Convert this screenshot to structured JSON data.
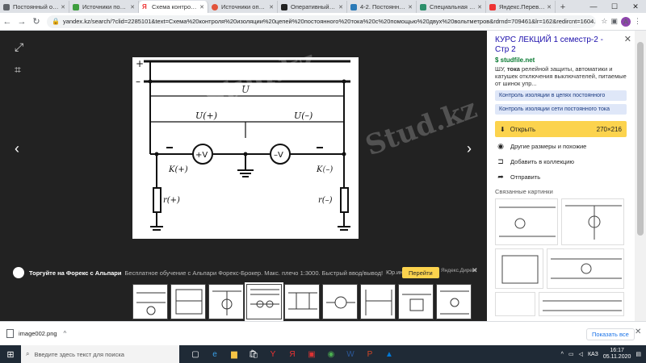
{
  "tabs": [
    {
      "label": "Постоянный опера",
      "color": "#5f6368"
    },
    {
      "label": "Источники постоя",
      "color": "#3e9e3e"
    },
    {
      "label": "Схема контроля из",
      "color": "#e33",
      "active": true
    },
    {
      "label": "Источники опера",
      "color": "#e2533a"
    },
    {
      "label": "Оперативный ток",
      "color": "#222"
    },
    {
      "label": "4-2. Постоянный оп",
      "color": "#2a7ab8"
    },
    {
      "label": "Специальная част",
      "color": "#2c8f6b"
    },
    {
      "label": "Яндекс.Переводч",
      "color": "#e33"
    }
  ],
  "window": {
    "minimize": "—",
    "maximize": "☐",
    "close": "✕",
    "new_tab": "+"
  },
  "address": {
    "url": "yandex.kz/search/?clid=2285101&text=Схема%20контроля%20изоляции%20цепей%20постоянного%20тока%20с%20помощью%20двух%20вольтметров&rdrnd=709461&lr=162&redircnt=1604...",
    "avatar": "А"
  },
  "viewer": {
    "watermark": "Stud.kz"
  },
  "ad": {
    "title": "Торгуйте на Форекс с Альпари",
    "text": "Бесплатное обучение с Альпари Форекс-Брокер. Макс. плечо 1:3000. Быстрый ввод/вывод!",
    "info": "Юр.информация",
    "button": "Перейти",
    "link": "Яндекс.Директ"
  },
  "side": {
    "title": "КУРС ЛЕКЦИЙ 1 семестр-2 - Стр 2",
    "site": "studfile.net",
    "desc_prefix": "ШУ, ",
    "desc_bold": "тока",
    "desc_rest": " релейной защиты, автоматики и катушек отключения выключателей, питаемые от шинок упр...",
    "tags": [
      "Контроль изоляции в цепях постоянного",
      "Контроль изоляции сети постоянного тока"
    ],
    "open_label": "Открыть",
    "open_size": "270×216",
    "actions": [
      "Другие размеры и похожие",
      "Добавить в коллекцию",
      "Отправить"
    ],
    "related_label": "Связанные картинки"
  },
  "download": {
    "filename": "image002.png",
    "show_all": "Показать все"
  },
  "taskbar": {
    "search_placeholder": "Введите здесь текст для поиска",
    "lang": "КАЗ",
    "time": "16:17",
    "date": "05.11.2020"
  },
  "diagram": {
    "plus": "+",
    "minus": "–",
    "u": "U",
    "u_plus": "U(+)",
    "u_minus": "U(–)",
    "v_plus": "+V",
    "v_minus": "–V",
    "k_plus": "K(+)",
    "k_minus": "K(–)",
    "r_plus": "r(+)",
    "r_minus": "r(–)"
  }
}
